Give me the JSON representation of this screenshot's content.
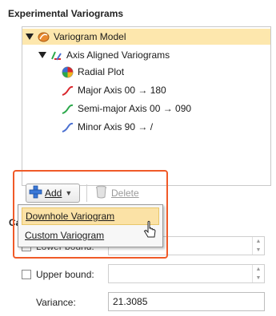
{
  "section_title": "Experimental Variograms",
  "tree": {
    "root": "Variogram Model",
    "group": "Axis Aligned Variograms",
    "items": [
      "Radial Plot",
      "Major Axis 00 → 180",
      "Semi-major Axis 00 → 090",
      "Minor Axis 90 → /"
    ]
  },
  "toolbar": {
    "add_label": "Add",
    "delete_label": "Delete"
  },
  "menu": {
    "items": [
      "Downhole Variogram",
      "Custom Variogram"
    ]
  },
  "partial_label": "Ca",
  "fields": {
    "lower_bound_label": "Lower bound:",
    "upper_bound_label": "Upper bound:",
    "variance_label": "Variance:",
    "variance_value": "21.3085"
  },
  "colors": {
    "highlight_border": "#f05a28",
    "selected_row": "#fde7ad"
  }
}
